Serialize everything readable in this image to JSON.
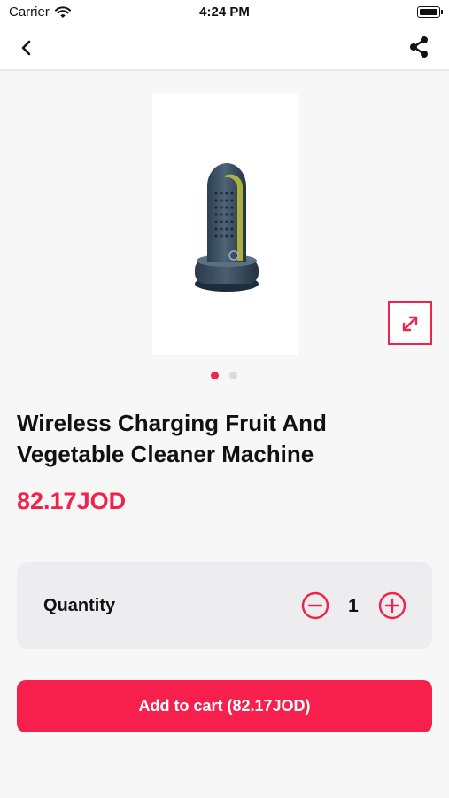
{
  "status_bar": {
    "carrier": "Carrier",
    "time": "4:24 PM"
  },
  "nav": {
    "back_icon": "chevron-left-icon",
    "share_icon": "share-icon"
  },
  "gallery": {
    "image": "cleaner-machine-product-photo",
    "expand_icon": "expand-icon",
    "slide_count": 2,
    "active_slide": 1
  },
  "product": {
    "title": "Wireless Charging Fruit And Vegetable Cleaner Machine",
    "price": "82.17JOD"
  },
  "quantity": {
    "label": "Quantity",
    "value": "1",
    "minus_icon": "minus-circle-icon",
    "plus_icon": "plus-circle-icon"
  },
  "cart": {
    "button_label": "Add to cart (82.17JOD)"
  },
  "colors": {
    "accent": "#f0234b",
    "background": "#f7f7f8",
    "card": "#ededf0"
  }
}
